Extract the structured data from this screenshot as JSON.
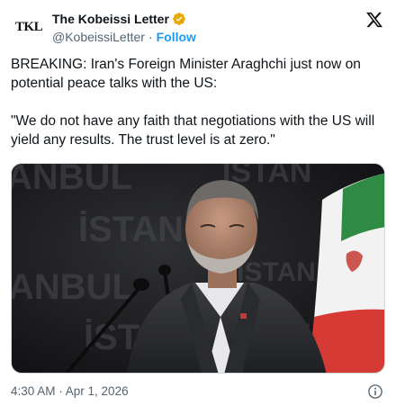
{
  "author": {
    "avatar_text": "TKL",
    "display_name": "The Kobeissi Letter",
    "handle": "@KobeissiLetter",
    "separator": "·",
    "follow_label": "Follow",
    "verified_color": "#e8a800"
  },
  "post": {
    "text": "BREAKING: Iran's Foreign Minister Araghchi just now on potential peace talks with the US:\n\n\"We do not have any faith that negotiations with the US will yield any results. The trust level is at zero.\""
  },
  "media": {
    "alt": "Photo of Iran's Foreign Minister Araghchi speaking at a podium with microphones, an Iranian flag behind him",
    "backdrop_words": [
      "ANBUL",
      "İSTAN",
      "İSTAN",
      "ANBUL",
      "İST",
      "ISTAN",
      "STAN"
    ]
  },
  "footer": {
    "timestamp": "4:30 AM · Apr 1, 2026"
  },
  "icons": {
    "brand": "x-logo-icon",
    "verified": "verified-badge-icon",
    "info": "info-icon"
  },
  "colors": {
    "link": "#1d9bf0",
    "secondary_text": "#536471"
  }
}
